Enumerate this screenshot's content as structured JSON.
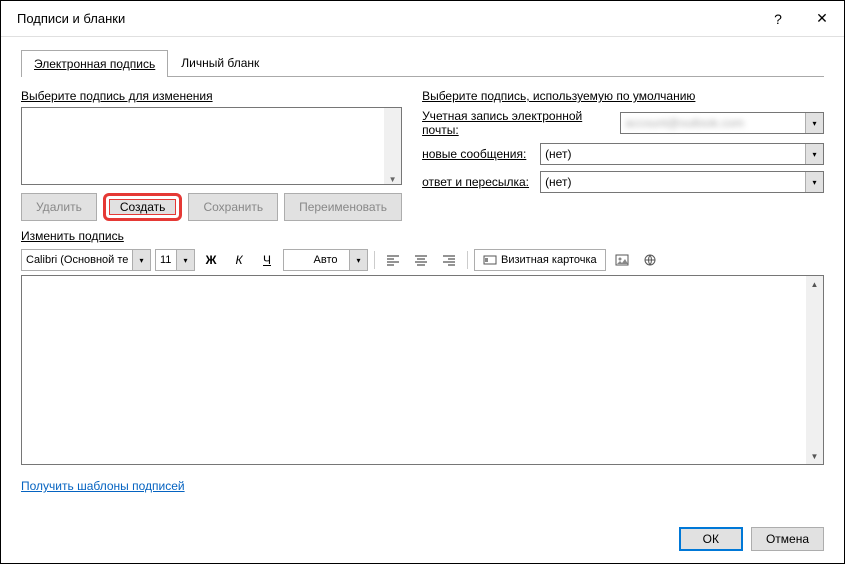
{
  "window": {
    "title": "Подписи и бланки"
  },
  "tabs": {
    "signature": "Электронная подпись",
    "stationery": "Личный бланк"
  },
  "left": {
    "select_label": "Выберите подпись для изменения",
    "delete": "Удалить",
    "create": "Создать",
    "save": "Сохранить",
    "rename": "Переименовать"
  },
  "right": {
    "default_label": "Выберите подпись, используемую по умолчанию",
    "account": "Учетная запись электронной почты:",
    "account_value": "account@outlook.com",
    "new_messages": "новые сообщения:",
    "new_value": "(нет)",
    "replies": "ответ и пересылка:",
    "replies_value": "(нет)"
  },
  "editor": {
    "label": "Изменить подпись",
    "font": "Calibri (Основной те",
    "size": "11",
    "bold": "Ж",
    "italic": "К",
    "underline": "Ч",
    "color": "Авто",
    "biz_card": "Визитная карточка"
  },
  "link": "Получить шаблоны подписей",
  "footer": {
    "ok": "ОК",
    "cancel": "Отмена"
  }
}
